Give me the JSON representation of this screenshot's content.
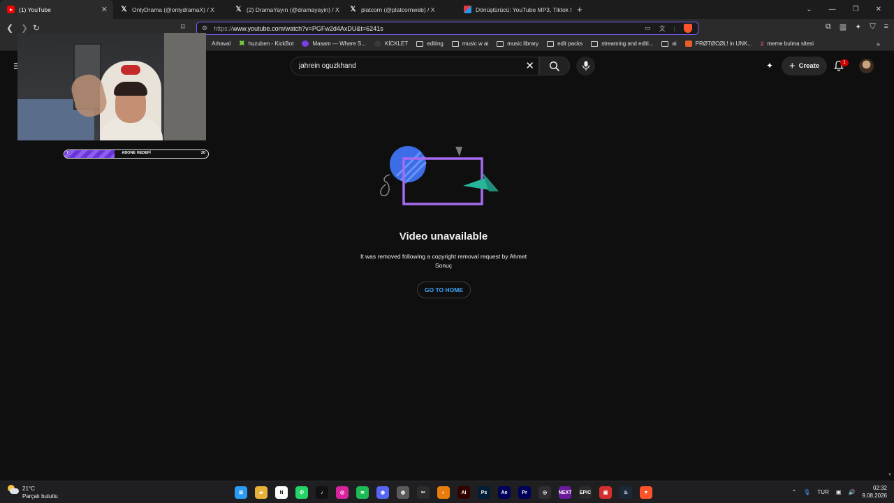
{
  "browser": {
    "tabs": [
      {
        "title": "(1) YouTube",
        "icon": "youtube-icon",
        "active": true
      },
      {
        "title": "OnlyDrama (@onlydramaX) / X",
        "icon": "x-icon"
      },
      {
        "title": "(2) DramaYayın (@dramayayin) / X",
        "icon": "x-icon"
      },
      {
        "title": "platcorn (@platcornweb) / X",
        "icon": "x-icon"
      },
      {
        "title": "Dönüştürücü: YouTube MP3, Tiktok M",
        "icon": "converter-icon"
      }
    ],
    "new_tab": "+",
    "url_scheme": "https://",
    "url_rest": "www.youtube.com/watch?v=PGFw2d4AxDU&t=6241s",
    "bookmarks": [
      {
        "label": "Arhaval",
        "icon": "arhaval-icon"
      },
      {
        "label": "huzuben - KickBot",
        "icon": "kick-icon"
      },
      {
        "label": "Masam — Where S...",
        "icon": "masam-icon"
      },
      {
        "label": "KİCKLET",
        "icon": "kicklet-icon"
      },
      {
        "label": "editing",
        "icon": "folder-icon"
      },
      {
        "label": "music w ai",
        "icon": "folder-icon"
      },
      {
        "label": "music library",
        "icon": "folder-icon"
      },
      {
        "label": "edit packs",
        "icon": "folder-icon"
      },
      {
        "label": "streaming and editi...",
        "icon": "folder-icon"
      },
      {
        "label": "ai",
        "icon": "folder-icon"
      },
      {
        "label": "PRØTØCØL! in UNK...",
        "icon": "protocol-icon"
      },
      {
        "label": "meme bulma sitesi",
        "icon": "meme-icon"
      }
    ]
  },
  "youtube": {
    "search_query": "jahrein oguzkhand",
    "create_label": "Create",
    "notification_count": "1"
  },
  "overlay": {
    "progress_low": "7",
    "progress_label": "ABONE HEDEFİ",
    "progress_high": "20",
    "progress_fraction": 0.35
  },
  "main": {
    "title": "Video unavailable",
    "description": "It was removed following a copyright removal request by Ahmet Sonuç",
    "button_label": "GO TO HOME"
  },
  "taskbar": {
    "temperature": "21°C",
    "weather": "Parçalı bulutlu",
    "language": "TUR",
    "time": "02:32",
    "date": "9.08.2026",
    "apps": [
      {
        "name": "windows-start-icon",
        "color": "#2b9cf2",
        "glyph": "⊞"
      },
      {
        "name": "file-explorer-icon",
        "color": "#e8b23a",
        "glyph": "▰"
      },
      {
        "name": "notion-icon",
        "color": "#ffffff",
        "glyph": "N"
      },
      {
        "name": "whatsapp-icon",
        "color": "#25d366",
        "glyph": "✆"
      },
      {
        "name": "tiktok-icon",
        "color": "#111111",
        "glyph": "♪"
      },
      {
        "name": "instagram-icon",
        "color": "#d6249f",
        "glyph": "◎"
      },
      {
        "name": "spotify-icon",
        "color": "#1db954",
        "glyph": "≋"
      },
      {
        "name": "discord-icon",
        "color": "#5865f2",
        "glyph": "◉"
      },
      {
        "name": "chrome-icon",
        "color": "#5a5a5a",
        "glyph": "◍"
      },
      {
        "name": "capcut-icon",
        "color": "#2c2c2c",
        "glyph": "✂"
      },
      {
        "name": "blender-icon",
        "color": "#e87d0d",
        "glyph": "◐"
      },
      {
        "name": "illustrator-icon",
        "color": "#330000",
        "glyph": "Ai"
      },
      {
        "name": "photoshop-icon",
        "color": "#001e36",
        "glyph": "Ps"
      },
      {
        "name": "after-effects-icon",
        "color": "#00005b",
        "glyph": "Ae"
      },
      {
        "name": "premiere-icon",
        "color": "#00005b",
        "glyph": "Pr"
      },
      {
        "name": "obs-icon",
        "color": "#302e31",
        "glyph": "◎"
      },
      {
        "name": "next-icon",
        "color": "#6a1b9a",
        "glyph": "NEXT"
      },
      {
        "name": "epic-games-icon",
        "color": "#2a2a2a",
        "glyph": "EPIC"
      },
      {
        "name": "app-red-icon",
        "color": "#d32f2f",
        "glyph": "▣"
      },
      {
        "name": "steam-icon",
        "color": "#1b2838",
        "glyph": "♨"
      },
      {
        "name": "brave-icon",
        "color": "#fb542b",
        "glyph": "▼"
      }
    ]
  }
}
